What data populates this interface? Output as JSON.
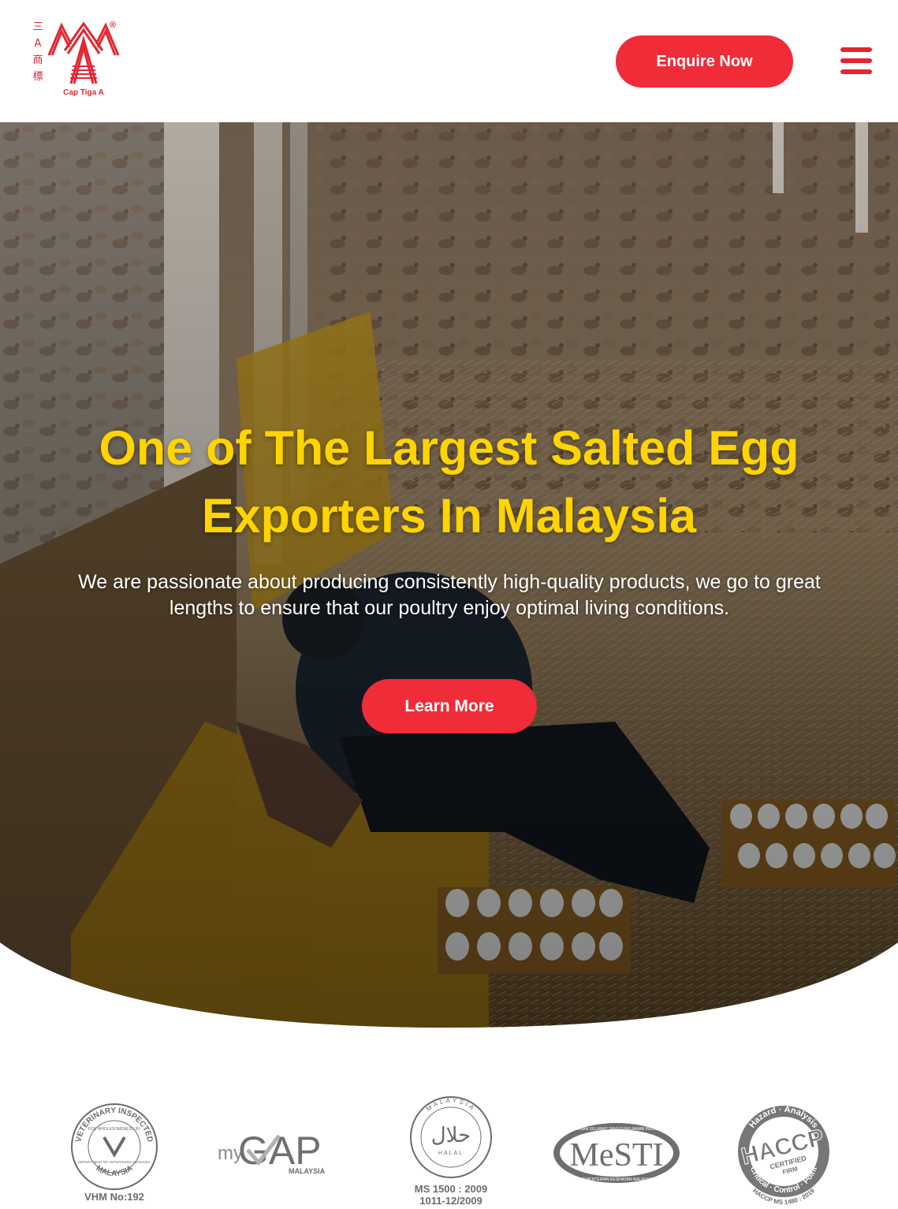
{
  "header": {
    "logo": {
      "cjk_chars": [
        "三",
        "A",
        "商",
        "標"
      ],
      "caption": "Cap Tiga A",
      "registered": "®"
    },
    "enquire_label": "Enquire Now",
    "menu_icon": "hamburger-icon"
  },
  "hero": {
    "title": "One of The Largest Salted Egg Exporters In Malaysia",
    "description": "We are passionate about producing consistently high-quality products, we go to great lengths to ensure that our poultry enjoy optimal living conditions.",
    "cta_label": "Learn More"
  },
  "certifications": [
    {
      "name": "veterinary-inspected-badge",
      "ring_top": "VETERINARY INSPECTED",
      "inner": "FOR WHOLESOMENESS BY",
      "dept": "DEPARTMENT OF VETERINARY SERVICES",
      "ring_bottom": "MALAYSIA",
      "caption": "VHM No:192"
    },
    {
      "name": "mygap-badge",
      "prefix": "my",
      "main": "GAP",
      "sub": "MALAYSIA"
    },
    {
      "name": "halal-badge",
      "ring": "MALAYSIA",
      "arabic": "حلال",
      "label": "HALAL",
      "caption_lines": [
        "MS 1500 : 2009",
        "1011-12/2009"
      ]
    },
    {
      "name": "mesti-badge",
      "top": "MAKANAN SELAMAT TANGGUNGJAWAB INDUSTRI",
      "main": "MeSTI",
      "bottom": "KEMENTERIAN KESIHATAN MALAYSIA"
    },
    {
      "name": "haccp-badge",
      "top": "Hazard · Analysis",
      "main": "HACCP",
      "certified": "CERTIFIED",
      "firm": "FIRM",
      "bottom": "Critical · Control · Point",
      "caption": "HACCP MS 1480 : 2019"
    }
  ],
  "colors": {
    "brand_red": "#e32630",
    "button_red": "#ef2c38",
    "title_yellow": "#ffd400",
    "badge_gray": "#6b6b6b"
  }
}
